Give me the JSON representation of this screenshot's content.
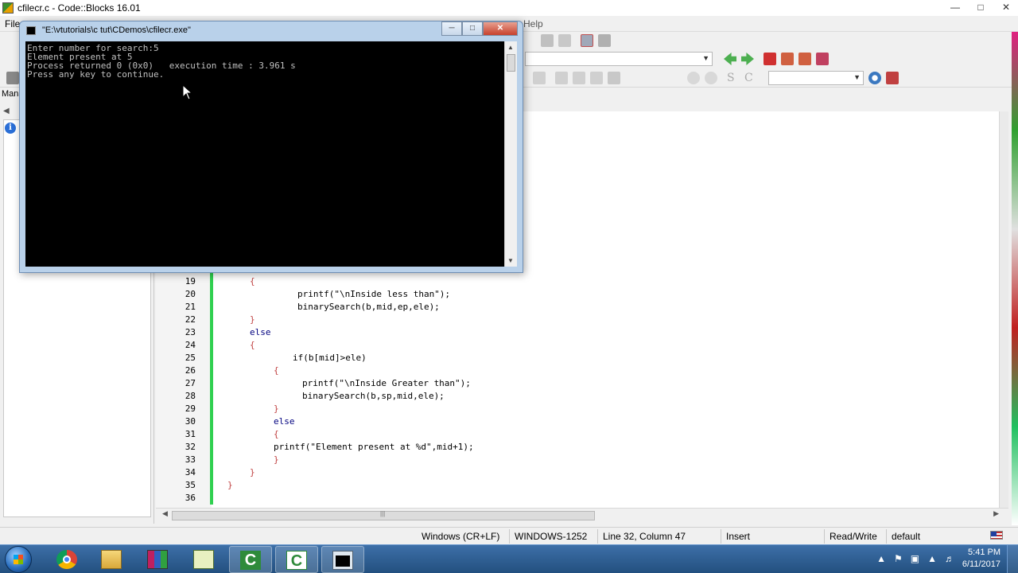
{
  "window": {
    "title": "cfilecr.c - Code::Blocks 16.01",
    "min_icon": "minimize-icon",
    "max_icon": "maximize-icon",
    "close_icon": "close-icon"
  },
  "menubar": {
    "first_item": "File",
    "last_item": "Help"
  },
  "management": {
    "label": "Manag"
  },
  "console": {
    "title": "\"E:\\vtutorials\\c tut\\CDemos\\cfilecr.exe\"",
    "lines": [
      "Enter number for search:5",
      "Element present at 5",
      "Process returned 0 (0x0)   execution time : 3.961 s",
      "Press any key to continue."
    ]
  },
  "editor": {
    "lines": [
      {
        "n": "19",
        "code": "{"
      },
      {
        "n": "20",
        "code": "printf(\"\\nInside less than\");"
      },
      {
        "n": "21",
        "code": "binarySearch(b,mid,ep,ele);"
      },
      {
        "n": "22",
        "code": "}"
      },
      {
        "n": "23",
        "code": "else"
      },
      {
        "n": "24",
        "code": "{"
      },
      {
        "n": "25",
        "code": "if(b[mid]>ele)"
      },
      {
        "n": "26",
        "code": "{"
      },
      {
        "n": "27",
        "code": "printf(\"\\nInside Greater than\");"
      },
      {
        "n": "28",
        "code": "binarySearch(b,sp,mid,ele);"
      },
      {
        "n": "29",
        "code": "}"
      },
      {
        "n": "30",
        "code": "else"
      },
      {
        "n": "31",
        "code": "{"
      },
      {
        "n": "32",
        "code": "printf(\"Element present at %d\",mid+1);"
      },
      {
        "n": "33",
        "code": "}"
      },
      {
        "n": "34",
        "code": "}"
      },
      {
        "n": "35",
        "code": "}"
      },
      {
        "n": "36",
        "code": ""
      }
    ]
  },
  "statusbar": {
    "line_endings": "Windows (CR+LF)",
    "encoding": "WINDOWS-1252",
    "position": "Line 32, Column 47",
    "mode": "Insert",
    "access": "Read/Write",
    "profile": "default"
  },
  "taskbar": {
    "apps": [
      "chrome-icon",
      "explorer-icon",
      "winrar-icon",
      "notepad-icon",
      "codeblocks-icon",
      "codeblocks-icon",
      "console-icon"
    ],
    "time": "5:41 PM",
    "date": "6/11/2017"
  },
  "colors": {
    "keyword": "#00007f",
    "string": "#0000ff",
    "number": "#f000f0",
    "brace": "#c04040",
    "change_bar": "#30d050"
  }
}
